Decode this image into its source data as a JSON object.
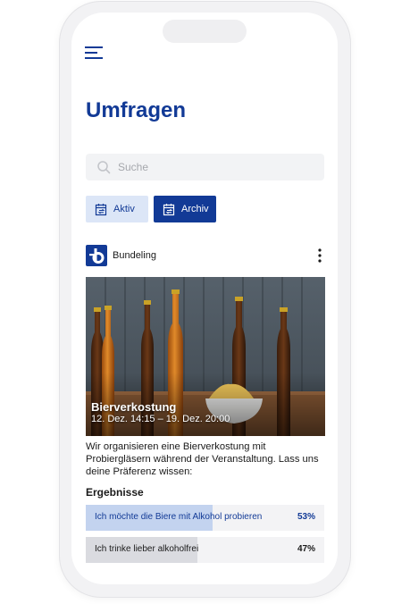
{
  "header": {
    "title": "Umfragen"
  },
  "search": {
    "placeholder": "Suche"
  },
  "tabs": [
    {
      "label": "Aktiv",
      "selected": false,
      "icon": "calendar-switch-icon"
    },
    {
      "label": "Archiv",
      "selected": true,
      "icon": "calendar-switch-icon"
    }
  ],
  "post": {
    "organization": "Bundeling",
    "event_title": "Bierverkostung",
    "event_date": "12. Dez. 14:15 – 19. Dez. 20:00",
    "description": "Wir organisieren eine Bierverkostung mit Probiergläsern während der Veranstaltung. Lass uns deine Präferenz wissen:"
  },
  "results": {
    "heading": "Ergebnisse",
    "options": [
      {
        "label": "Ich möchte die Biere mit Alkohol probieren",
        "percent_text": "53%",
        "percent": 53
      },
      {
        "label": "Ich trinke lieber alkoholfrei",
        "percent_text": "47%",
        "percent": 47
      }
    ]
  },
  "colors": {
    "brand": "#123a96",
    "tab_inactive_bg": "#dce6f7",
    "bar_leading": "#c3d3ef",
    "bar_other": "#dadbe0"
  }
}
